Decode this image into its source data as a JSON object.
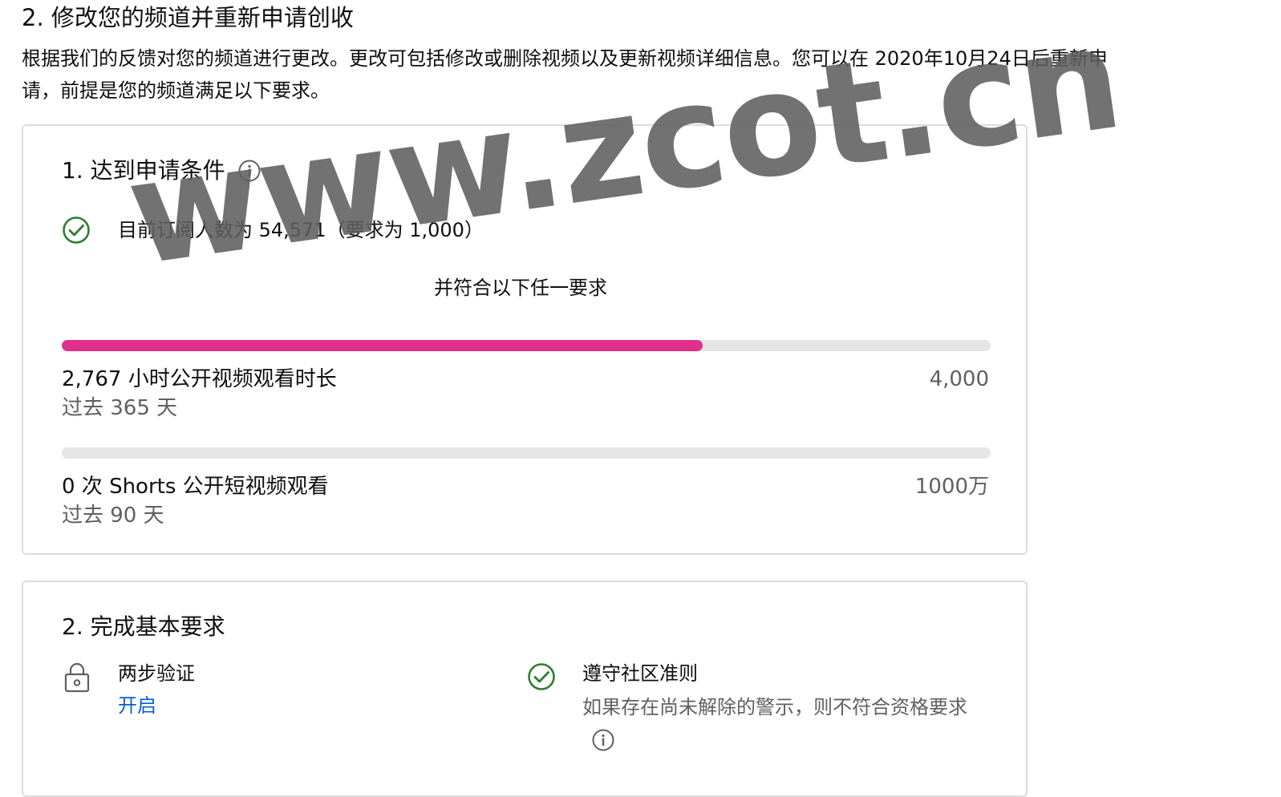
{
  "step": {
    "heading": "2. 修改您的频道并重新申请创收",
    "description": "根据我们的反馈对您的频道进行更改。更改可包括修改或删除视频以及更新视频详细信息。您可以在 2020年10月24日后重新申请，前提是您的频道满足以下要求。"
  },
  "eligibility": {
    "title": "1. 达到申请条件",
    "subscribers": {
      "text": "目前订阅人数为 54,571（要求为 1,000）",
      "status": "met"
    },
    "either_requirement_text": "并符合以下任一要求",
    "watch_hours": {
      "label": "2,767 小时公开视频观看时长",
      "period": "过去 365 天",
      "target": "4,000",
      "progress": 0.69
    },
    "shorts_views": {
      "label": "0 次 Shorts 公开短视频观看",
      "period": "过去 90 天",
      "target": "1000万",
      "progress": 0
    }
  },
  "basics": {
    "title": "2. 完成基本要求",
    "two_step": {
      "label": "两步验证",
      "action": "开启"
    },
    "guidelines": {
      "label": "遵守社区准则",
      "note": "如果存在尚未解除的警示，则不符合资格要求"
    }
  },
  "watermark": {
    "text": "www.zcot.cn"
  },
  "colors": {
    "progress_fill": "#e0318a",
    "progress_track": "#e5e5e5",
    "check_green": "#2e7d32",
    "link_blue": "#065fd4"
  }
}
